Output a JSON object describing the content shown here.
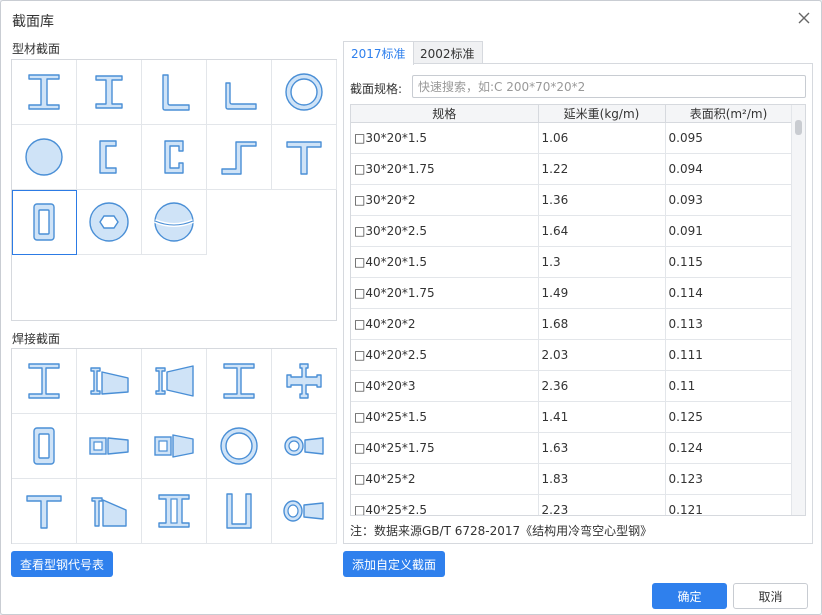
{
  "window": {
    "title": "截面库"
  },
  "left": {
    "profiles_label": "型材截面",
    "welded_label": "焊接截面",
    "profile_icons": [
      "i-beam-icon",
      "h-beam-icon",
      "equal-angle-icon",
      "unequal-angle-icon",
      "circular-tube-icon",
      "solid-round-icon",
      "lipped-channel-icon",
      "channel-icon",
      "z-section-icon",
      "t-section-icon",
      "rectangular-tube-icon",
      "hex-tube-icon",
      "sphere-icon"
    ],
    "welded_icons": [
      "welded-i-icon",
      "tapered-h-icon",
      "tapered-i-icon",
      "welded-h-icon",
      "cross-section-icon",
      "welded-box-icon",
      "tapered-box-icon",
      "tapered-rect-tube-icon",
      "welded-circular-icon",
      "tapered-circular-icon",
      "welded-t-icon",
      "tapered-t-icon",
      "double-i-icon",
      "u-section-icon",
      "tapered-oval-icon"
    ],
    "view_codes_button": "查看型钢代号表"
  },
  "right": {
    "tabs": [
      "2017标准",
      "2002标准"
    ],
    "spec_label": "截面规格:",
    "search_placeholder": "快速搜索，如:C 200*70*20*2",
    "columns": [
      "规格",
      "延米重(kg/m)",
      "表面积(m²/m)"
    ],
    "rows": [
      [
        "□30*20*1.5",
        "1.06",
        "0.095"
      ],
      [
        "□30*20*1.75",
        "1.22",
        "0.094"
      ],
      [
        "□30*20*2",
        "1.36",
        "0.093"
      ],
      [
        "□30*20*2.5",
        "1.64",
        "0.091"
      ],
      [
        "□40*20*1.5",
        "1.3",
        "0.115"
      ],
      [
        "□40*20*1.75",
        "1.49",
        "0.114"
      ],
      [
        "□40*20*2",
        "1.68",
        "0.113"
      ],
      [
        "□40*20*2.5",
        "2.03",
        "0.111"
      ],
      [
        "□40*20*3",
        "2.36",
        "0.11"
      ],
      [
        "□40*25*1.5",
        "1.41",
        "0.125"
      ],
      [
        "□40*25*1.75",
        "1.63",
        "0.124"
      ],
      [
        "□40*25*2",
        "1.83",
        "0.123"
      ],
      [
        "□40*25*2.5",
        "2.23",
        "0.121"
      ]
    ],
    "note": "注：数据来源GB/T 6728-2017《结构用冷弯空心型钢》",
    "add_custom_button": "添加自定义截面"
  },
  "footer": {
    "ok": "确定",
    "cancel": "取消"
  },
  "colors": {
    "accent": "#2f80ed",
    "icon_fill": "#cfe3f7",
    "icon_stroke": "#4a8fd6"
  }
}
